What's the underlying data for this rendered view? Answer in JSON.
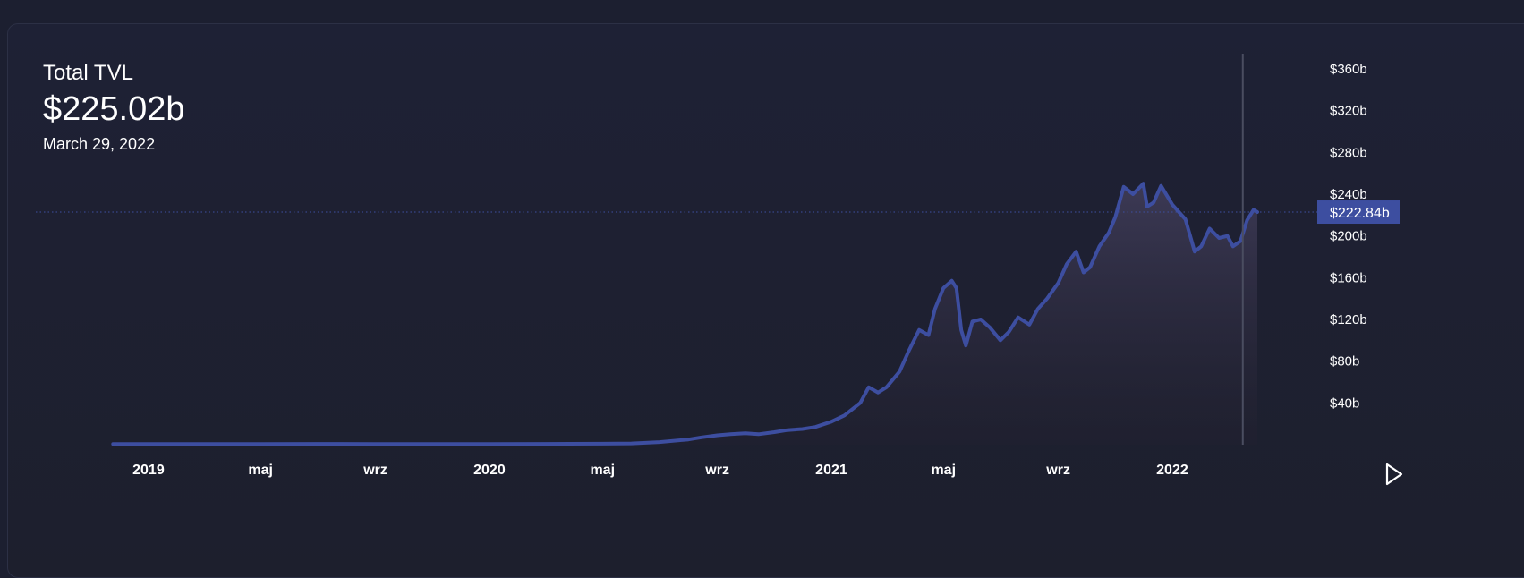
{
  "header": {
    "title": "Total TVL",
    "value": "$225.02b",
    "date": "March 29, 2022"
  },
  "controls": {
    "play_icon": "play-icon"
  },
  "colors": {
    "line": "#3d4ea0",
    "price_tag_bg": "#3d4ea0",
    "crosshair": "#4a4d60",
    "text": "#ffffff"
  },
  "chart_data": {
    "type": "area",
    "ylim": [
      0,
      380
    ],
    "y_ticks": [
      40,
      80,
      120,
      160,
      200,
      240,
      280,
      320,
      360
    ],
    "y_tick_labels": [
      "$40b",
      "$80b",
      "$120b",
      "$160b",
      "$200b",
      "$240b",
      "$280b",
      "$320b",
      "$360b"
    ],
    "x_ticks": [
      "2019-01-01",
      "2019-05-01",
      "2019-09-01",
      "2020-01-01",
      "2020-05-01",
      "2020-09-01",
      "2021-01-01",
      "2021-05-01",
      "2021-09-01",
      "2022-01-01"
    ],
    "x_tick_labels": [
      "2019",
      "maj",
      "wrz",
      "2020",
      "maj",
      "wrz",
      "2021",
      "maj",
      "wrz",
      "2022"
    ],
    "xlim": [
      "2018-11-18",
      "2022-04-03"
    ],
    "last_value_label": "$222.84b",
    "last_value": 222.84,
    "crosshair_date": "2022-03-29",
    "grid": false,
    "series": [
      {
        "points": [
          [
            "2018-11-24",
            0.6
          ],
          [
            "2019-01-01",
            0.6
          ],
          [
            "2019-03-01",
            0.6
          ],
          [
            "2019-05-01",
            0.7
          ],
          [
            "2019-07-01",
            0.8
          ],
          [
            "2019-09-01",
            0.7
          ],
          [
            "2019-11-01",
            0.7
          ],
          [
            "2020-01-01",
            0.7
          ],
          [
            "2020-03-01",
            0.8
          ],
          [
            "2020-05-01",
            0.9
          ],
          [
            "2020-06-01",
            1.2
          ],
          [
            "2020-07-01",
            2.5
          ],
          [
            "2020-08-01",
            5
          ],
          [
            "2020-08-15",
            7
          ],
          [
            "2020-09-01",
            9
          ],
          [
            "2020-09-15",
            10
          ],
          [
            "2020-10-01",
            11
          ],
          [
            "2020-10-15",
            10
          ],
          [
            "2020-11-01",
            12
          ],
          [
            "2020-11-15",
            14
          ],
          [
            "2020-12-01",
            15
          ],
          [
            "2020-12-15",
            17
          ],
          [
            "2021-01-01",
            22
          ],
          [
            "2021-01-15",
            28
          ],
          [
            "2021-02-01",
            40
          ],
          [
            "2021-02-10",
            55
          ],
          [
            "2021-02-20",
            50
          ],
          [
            "2021-03-01",
            55
          ],
          [
            "2021-03-15",
            70
          ],
          [
            "2021-03-25",
            90
          ],
          [
            "2021-04-05",
            110
          ],
          [
            "2021-04-15",
            105
          ],
          [
            "2021-04-22",
            130
          ],
          [
            "2021-05-01",
            150
          ],
          [
            "2021-05-10",
            157
          ],
          [
            "2021-05-15",
            150
          ],
          [
            "2021-05-20",
            110
          ],
          [
            "2021-05-25",
            95
          ],
          [
            "2021-06-01",
            118
          ],
          [
            "2021-06-10",
            120
          ],
          [
            "2021-06-20",
            112
          ],
          [
            "2021-07-01",
            100
          ],
          [
            "2021-07-10",
            108
          ],
          [
            "2021-07-20",
            122
          ],
          [
            "2021-08-01",
            115
          ],
          [
            "2021-08-10",
            130
          ],
          [
            "2021-08-20",
            140
          ],
          [
            "2021-09-01",
            155
          ],
          [
            "2021-09-10",
            173
          ],
          [
            "2021-09-20",
            185
          ],
          [
            "2021-09-28",
            165
          ],
          [
            "2021-10-05",
            170
          ],
          [
            "2021-10-15",
            190
          ],
          [
            "2021-10-25",
            203
          ],
          [
            "2021-11-01",
            218
          ],
          [
            "2021-11-10",
            247
          ],
          [
            "2021-11-20",
            240
          ],
          [
            "2021-12-01",
            250
          ],
          [
            "2021-12-05",
            228
          ],
          [
            "2021-12-12",
            232
          ],
          [
            "2021-12-20",
            248
          ],
          [
            "2022-01-01",
            230
          ],
          [
            "2022-01-15",
            216
          ],
          [
            "2022-01-25",
            185
          ],
          [
            "2022-02-01",
            190
          ],
          [
            "2022-02-10",
            207
          ],
          [
            "2022-02-20",
            198
          ],
          [
            "2022-03-01",
            200
          ],
          [
            "2022-03-07",
            190
          ],
          [
            "2022-03-15",
            195
          ],
          [
            "2022-03-22",
            215
          ],
          [
            "2022-03-29",
            225.02
          ],
          [
            "2022-04-02",
            222.84
          ]
        ]
      }
    ]
  }
}
